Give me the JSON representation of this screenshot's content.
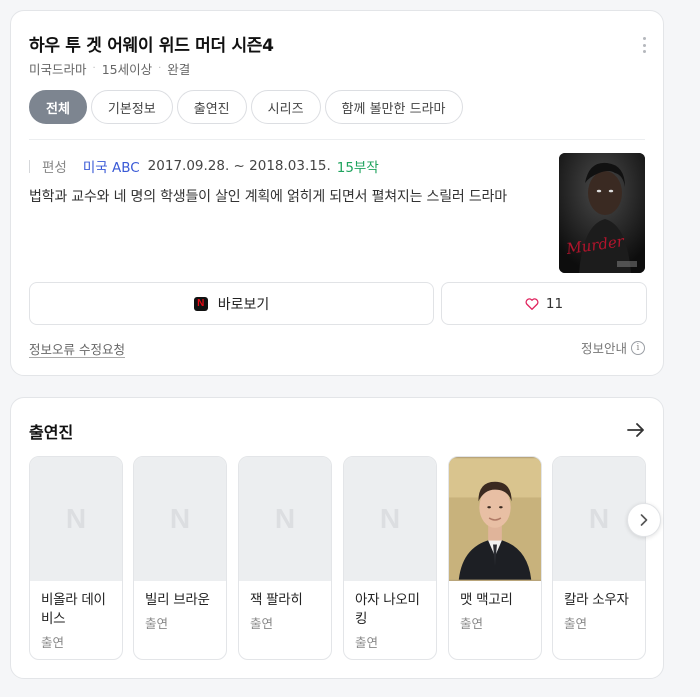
{
  "show": {
    "title": "하우 투 겟 어웨이 위드 머더 시즌4",
    "meta": [
      "미국드라마",
      "15세이상",
      "완결"
    ]
  },
  "tabs": [
    "전체",
    "기본정보",
    "출연진",
    "시리즈",
    "함께 볼만한 드라마"
  ],
  "airing": {
    "label": "편성",
    "country": "미국 ABC",
    "dates": "2017.09.28. ~ 2018.03.15.",
    "episodes": "15부작"
  },
  "synopsis": "법학과 교수와 네 명의 학생들이 살인 계획에 얽히게 되면서 펼쳐지는 스릴러 드라마",
  "poster": {
    "text": "Murder",
    "icon": "poster-image"
  },
  "actions": {
    "watch_label": "바로보기",
    "watch_icon": "netflix-icon",
    "netflix_glyph": "N",
    "like_count": "11",
    "like_icon": "heart-icon"
  },
  "footer": {
    "report_label": "정보오류 수정요청",
    "guide_label": "정보안내",
    "info_glyph": "i"
  },
  "cast_section": {
    "title": "출연진",
    "placeholder_glyph": "N",
    "members": [
      {
        "name": "비올라 데이비스",
        "role": "출연"
      },
      {
        "name": "빌리 브라운",
        "role": "출연"
      },
      {
        "name": "잭 팔라히",
        "role": "출연"
      },
      {
        "name": "아자 나오미 킹",
        "role": "출연"
      },
      {
        "name": "맷 맥고리",
        "role": "출연"
      },
      {
        "name": "칼라 소우자",
        "role": "출연"
      }
    ]
  },
  "colors": {
    "active_tab": "#7d8590",
    "country_link": "#3a5ad6",
    "episodes": "#1fa35e",
    "heart": "#e0245e"
  }
}
